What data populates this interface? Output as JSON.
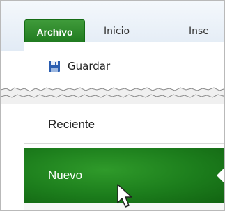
{
  "ribbon": {
    "tabs": [
      {
        "label": "Archivo"
      },
      {
        "label": "Inicio"
      },
      {
        "label": "Inse"
      }
    ]
  },
  "backstage": {
    "save_label": "Guardar",
    "recent_label": "Reciente",
    "new_label": "Nuevo"
  },
  "colors": {
    "file_tab": "#2b8a27",
    "selected_item": "#1f7f1f",
    "save_icon": "#2a5db0"
  },
  "icons": [
    "floppy-disk-icon",
    "mouse-pointer-icon"
  ]
}
